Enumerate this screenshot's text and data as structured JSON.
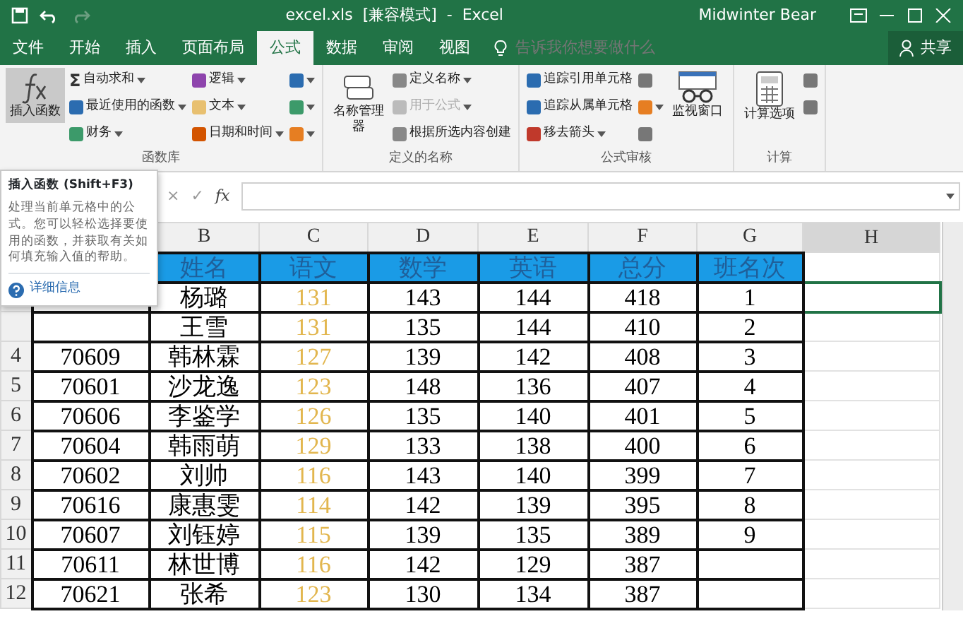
{
  "window": {
    "title": "excel.xls  [兼容模式]  -  Excel",
    "user": "Midwinter Bear"
  },
  "tabs": [
    {
      "label": "文件",
      "selected": false
    },
    {
      "label": "开始",
      "selected": false
    },
    {
      "label": "插入",
      "selected": false
    },
    {
      "label": "页面布局",
      "selected": false
    },
    {
      "label": "公式",
      "selected": true
    },
    {
      "label": "数据",
      "selected": false
    },
    {
      "label": "审阅",
      "selected": false
    },
    {
      "label": "视图",
      "selected": false
    }
  ],
  "tell_me": {
    "placeholder": "告诉我你想要做什么"
  },
  "share": "共享",
  "ribbon": {
    "groups": [
      {
        "label": "函数库",
        "columns": [
          [
            {
              "kind": "big",
              "label": "插入函数",
              "highlighted": true
            }
          ],
          [
            {
              "kind": "small",
              "glyph": "Σ",
              "label": "自动求和",
              "color": "#333333",
              "dropdown": true,
              "disabled": false
            },
            {
              "kind": "small",
              "label": "最近使用的函数",
              "color": "#2b6cb0",
              "dropdown": true,
              "disabled": false
            },
            {
              "kind": "small",
              "label": "财务",
              "color": "#3c9a6a",
              "dropdown": true,
              "disabled": false
            }
          ],
          [
            {
              "kind": "small",
              "label": "逻辑",
              "color": "#8e44ad",
              "dropdown": true,
              "disabled": false
            },
            {
              "kind": "small",
              "label": "文本",
              "color": "#e8c070",
              "dropdown": true,
              "disabled": false
            },
            {
              "kind": "small",
              "label": "日期和时间",
              "color": "#d35400",
              "dropdown": true,
              "disabled": false
            }
          ],
          [
            {
              "kind": "icon",
              "color": "#2b6cb0",
              "dropdown": true
            },
            {
              "kind": "icon",
              "color": "#3c9a6a",
              "dropdown": true
            },
            {
              "kind": "icon",
              "color": "#e67e22",
              "dropdown": true
            }
          ]
        ]
      },
      {
        "label": "定义的名称",
        "columns": [
          [
            {
              "kind": "big",
              "label": "名称管理器",
              "highlighted": false
            }
          ],
          [
            {
              "kind": "small",
              "label": "定义名称",
              "color": "#888888",
              "dropdown": true,
              "disabled": false
            },
            {
              "kind": "small",
              "label": "用于公式",
              "color": "#bbbbbb",
              "dropdown": true,
              "disabled": true
            },
            {
              "kind": "small",
              "label": "根据所选内容创建",
              "color": "#888888",
              "dropdown": false,
              "disabled": false
            }
          ]
        ]
      },
      {
        "label": "公式审核",
        "columns": [
          [
            {
              "kind": "small",
              "label": "追踪引用单元格",
              "color": "#2b6cb0",
              "dropdown": false,
              "disabled": false
            },
            {
              "kind": "small",
              "label": "追踪从属单元格",
              "color": "#2b6cb0",
              "dropdown": false,
              "disabled": false
            },
            {
              "kind": "small",
              "label": "移去箭头",
              "color": "#c0392b",
              "dropdown": true,
              "disabled": false
            }
          ],
          [
            {
              "kind": "icon",
              "color": "#777777",
              "dropdown": false
            },
            {
              "kind": "icon",
              "color": "#e67e22",
              "dropdown": true
            },
            {
              "kind": "icon",
              "color": "#777777",
              "dropdown": false
            }
          ],
          [
            {
              "kind": "big",
              "label": "监视窗口",
              "highlighted": false
            }
          ]
        ]
      },
      {
        "label": "计算",
        "columns": [
          [
            {
              "kind": "big",
              "label": "计算选项",
              "highlighted": false
            }
          ],
          [
            {
              "kind": "icon",
              "color": "#777777",
              "dropdown": false
            },
            {
              "kind": "icon",
              "color": "#777777",
              "dropdown": false
            }
          ]
        ]
      }
    ]
  },
  "tooltip": {
    "title": "插入函数 (Shift+F3)",
    "body": "处理当前单元格中的公式。您可以轻松选择要使用的函数，并获取有关如何填充输入值的帮助。",
    "link": "详细信息"
  },
  "formula_bar": {
    "cancel": "×",
    "enter": "✓",
    "function": "fx"
  },
  "table": {
    "columns": [
      {
        "letter": "B",
        "selected": false
      },
      {
        "letter": "C",
        "color": "#e2b64e",
        "selected": false
      },
      {
        "letter": "D",
        "selected": false
      },
      {
        "letter": "E",
        "selected": false
      },
      {
        "letter": "F",
        "selected": false
      },
      {
        "letter": "G",
        "selected": false
      },
      {
        "letter": "H",
        "selected": true
      }
    ],
    "rows": [
      {
        "kind": "heading",
        "selected": false,
        "cells": [
          "姓名",
          "语文",
          "数学",
          "英语",
          "总分",
          "班名次"
        ]
      },
      {
        "kind": "data",
        "selected": true,
        "cells": [
          "杨璐",
          "131",
          "143",
          "144",
          "418",
          "1"
        ]
      },
      {
        "kind": "data",
        "selected": false,
        "cells": [
          "王雪",
          "131",
          "135",
          "144",
          "410",
          "2"
        ]
      },
      {
        "number": "4",
        "id": "70609",
        "kind": "data",
        "selected": false,
        "cells": [
          "韩林霖",
          "127",
          "139",
          "142",
          "408",
          "3"
        ]
      },
      {
        "number": "5",
        "id": "70601",
        "kind": "data",
        "selected": false,
        "cells": [
          "沙龙逸",
          "123",
          "148",
          "136",
          "407",
          "4"
        ]
      },
      {
        "number": "6",
        "id": "70606",
        "kind": "data",
        "selected": false,
        "cells": [
          "李鉴学",
          "126",
          "135",
          "140",
          "401",
          "5"
        ]
      },
      {
        "number": "7",
        "id": "70604",
        "kind": "data",
        "selected": false,
        "cells": [
          "韩雨萌",
          "129",
          "133",
          "138",
          "400",
          "6"
        ]
      },
      {
        "number": "8",
        "id": "70602",
        "kind": "data",
        "selected": false,
        "cells": [
          "刘帅",
          "116",
          "143",
          "140",
          "399",
          "7"
        ]
      },
      {
        "number": "9",
        "id": "70616",
        "kind": "data",
        "selected": false,
        "cells": [
          "康惠雯",
          "114",
          "142",
          "139",
          "395",
          "8"
        ]
      },
      {
        "number": "10",
        "id": "70607",
        "kind": "data",
        "selected": false,
        "cells": [
          "刘钰婷",
          "115",
          "139",
          "135",
          "389",
          "9"
        ]
      },
      {
        "number": "11",
        "id": "70611",
        "kind": "data",
        "selected": false,
        "cells": [
          "林世博",
          "116",
          "142",
          "129",
          "387"
        ]
      },
      {
        "number": "12",
        "id": "70621",
        "kind": "data",
        "selected": false,
        "cells": [
          "张希",
          "123",
          "130",
          "134",
          "387"
        ]
      }
    ]
  }
}
